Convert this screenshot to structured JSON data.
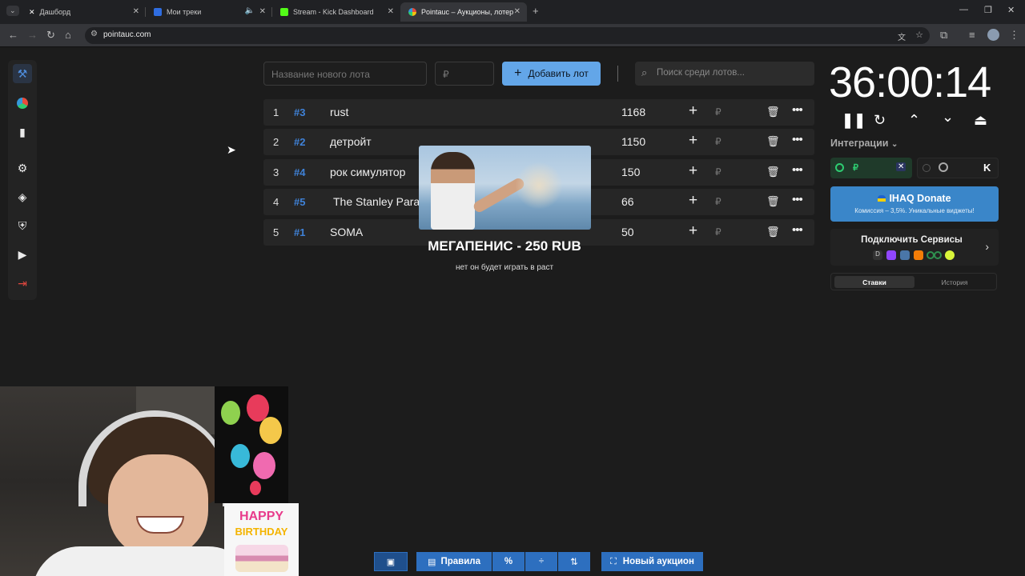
{
  "browser": {
    "tabs": [
      {
        "title": "Дашборд",
        "active": false
      },
      {
        "title": "Мои треки",
        "active": false
      },
      {
        "title": "Stream - Kick Dashboard",
        "active": false
      },
      {
        "title": "Pointauc – Аукционы, лотерея",
        "active": true
      }
    ],
    "url": "pointauc.com"
  },
  "toolbar": {
    "new_lot_placeholder": "Название нового лота",
    "price_placeholder": "₽",
    "add_button": "Добавить лот",
    "search_placeholder": "Поиск среди лотов..."
  },
  "lots": [
    {
      "rank": "1",
      "fav": "#3",
      "name": "rust",
      "amount": "1168"
    },
    {
      "rank": "2",
      "fav": "#2",
      "name": "детройт",
      "amount": "1150"
    },
    {
      "rank": "3",
      "fav": "#4",
      "name": "рок симулятор",
      "amount": "150"
    },
    {
      "rank": "4",
      "fav": "#5",
      "name": "The Stanley Para",
      "amount": "66"
    },
    {
      "rank": "5",
      "fav": "#1",
      "name": "SOMA",
      "amount": "50"
    }
  ],
  "lot_currency": "₽",
  "donation": {
    "title": "МЕГАПЕНИС - 250 RUB",
    "message": "нет он будет играть в раст"
  },
  "timer": "36:00:14",
  "integrations": {
    "label": "Интеграции",
    "currency": "₽"
  },
  "ihaq": {
    "title": "IHAQ Donate",
    "subtitle": "Комиссия – 3,5%. Уникальные виджеты!"
  },
  "services": {
    "title": "Подключить Сервисы"
  },
  "history_tabs": {
    "bets": "Ставки",
    "history": "История"
  },
  "bottom": {
    "rules": "Правила",
    "percent": "%",
    "new_auction": "Новый аукцион"
  },
  "overlay": {
    "bday_line1": "HAPPY",
    "bday_line2": "BIRTHDAY"
  }
}
